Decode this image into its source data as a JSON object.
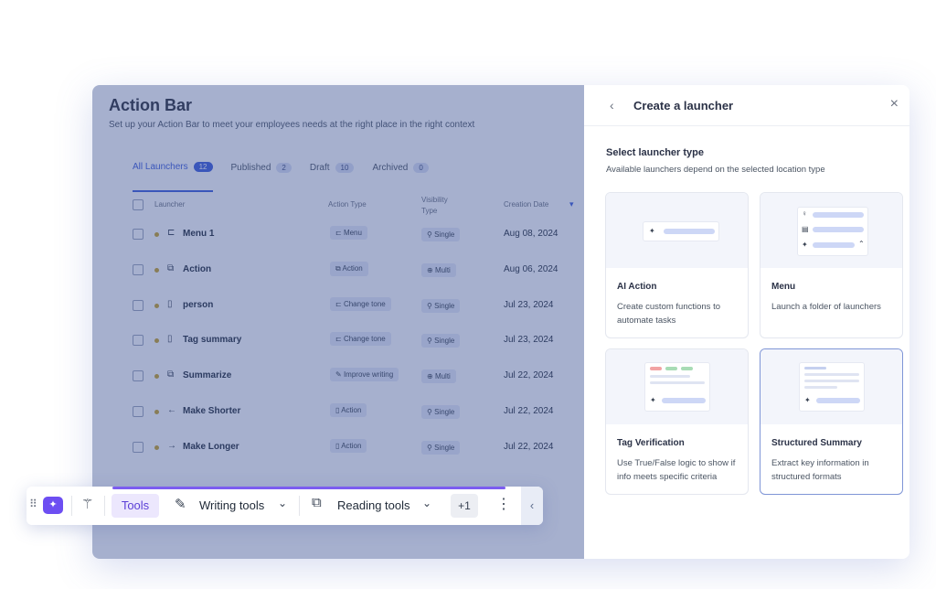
{
  "action_bar": {
    "title": "Action Bar",
    "subtitle": "Set up your Action Bar to meet your employees needs at the right place in the right context",
    "tabs": [
      {
        "label": "All Launchers",
        "count": "12"
      },
      {
        "label": "Published",
        "count": "2"
      },
      {
        "label": "Draft",
        "count": "10"
      },
      {
        "label": "Archived",
        "count": "0"
      }
    ],
    "columns": {
      "launcher": "Launcher",
      "action_type": "Action Type",
      "visibility": "Visibility Type",
      "creation_date": "Creation Date"
    },
    "rows": [
      {
        "icon": "⊏",
        "name": "Menu 1",
        "action": "Menu",
        "action_icon": "⊏",
        "visibility": "Single",
        "date": "Aug 08, 2024"
      },
      {
        "icon": "⧉",
        "name": "Action",
        "action": "Action",
        "action_icon": "⧉",
        "visibility": "Multi",
        "date": "Aug 06, 2024"
      },
      {
        "icon": "▯",
        "name": "person",
        "action": "Change tone",
        "action_icon": "⊏",
        "visibility": "Single",
        "date": "Jul 23, 2024"
      },
      {
        "icon": "▯",
        "name": "Tag summary",
        "action": "Change tone",
        "action_icon": "⊏",
        "visibility": "Single",
        "date": "Jul 23, 2024"
      },
      {
        "icon": "⧉",
        "name": "Summarize",
        "action": "Improve writing",
        "action_icon": "✎",
        "visibility": "Multi",
        "date": "Jul 22, 2024"
      },
      {
        "icon": "←",
        "name": "Make Shorter",
        "action": "Action",
        "action_icon": "▯",
        "visibility": "Single",
        "date": "Jul 22, 2024"
      },
      {
        "icon": "→",
        "name": "Make Longer",
        "action": "Action",
        "action_icon": "▯",
        "visibility": "Single",
        "date": "Jul 22, 2024"
      }
    ]
  },
  "panel": {
    "back": "‹",
    "title": "Create a launcher",
    "close": "×",
    "section_title": "Select launcher type",
    "section_sub": "Available launchers depend on the selected location type",
    "cards": [
      {
        "name": "AI Action",
        "desc": "Create custom functions to automate tasks"
      },
      {
        "name": "Menu",
        "desc": "Launch a folder of launchers"
      },
      {
        "name": "Tag Verification",
        "desc": "Use True/False logic to show if info meets specific criteria"
      },
      {
        "name": "Structured Summary",
        "desc": "Extract key information in structured formats"
      }
    ]
  },
  "toolbar": {
    "grip": "⠿",
    "logo": "✦",
    "wand": "⚚",
    "tools": "Tools",
    "writing_icon": "✎",
    "writing": "Writing tools",
    "writing_chev": "⌄",
    "reading_icon": "⧉",
    "reading": "Reading tools",
    "reading_chev": "⌄",
    "plus": "+1",
    "more": "⋮",
    "collapse": "‹"
  }
}
